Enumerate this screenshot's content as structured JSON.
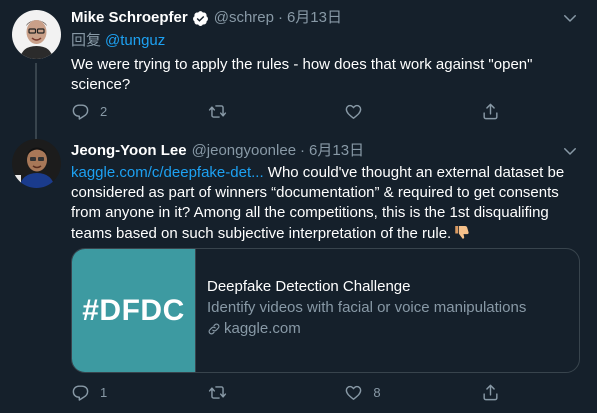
{
  "tweets": [
    {
      "name": "Mike Schroepfer",
      "verified": true,
      "handle": "@schrep",
      "separator": "·",
      "date": "6月13日",
      "reply_prefix": "回复",
      "reply_to": "@tunguz",
      "text": "We were trying to apply the rules - how does that work against \"open\" science?",
      "actions": {
        "reply_count": "2",
        "retweet_count": "",
        "like_count": ""
      }
    },
    {
      "name": "Jeong-Yoon Lee",
      "handle": "@jeongyoonlee",
      "separator": "·",
      "date": "6月13日",
      "link_text": "kaggle.com/c/deepfake-det...",
      "text": " Who could've thought an external dataset be considered as part of winners “documentation” & required to get consents from anyone in it? Among all the competitions, this is the 1st disqualifing teams based on such subjective interpretation of the rule.",
      "emoji": "thumbs-down",
      "card": {
        "image_text": "#DFDC",
        "title": "Deepfake Detection Challenge",
        "description": "Identify videos with facial or voice manipulations",
        "domain": "kaggle.com"
      },
      "actions": {
        "reply_count": "1",
        "retweet_count": "",
        "like_count": "8"
      }
    }
  ],
  "colors": {
    "background": "#15202b",
    "accent": "#1da1f2",
    "muted": "#8899a6",
    "border": "#38444d",
    "card_image": "#3d9aa1"
  }
}
